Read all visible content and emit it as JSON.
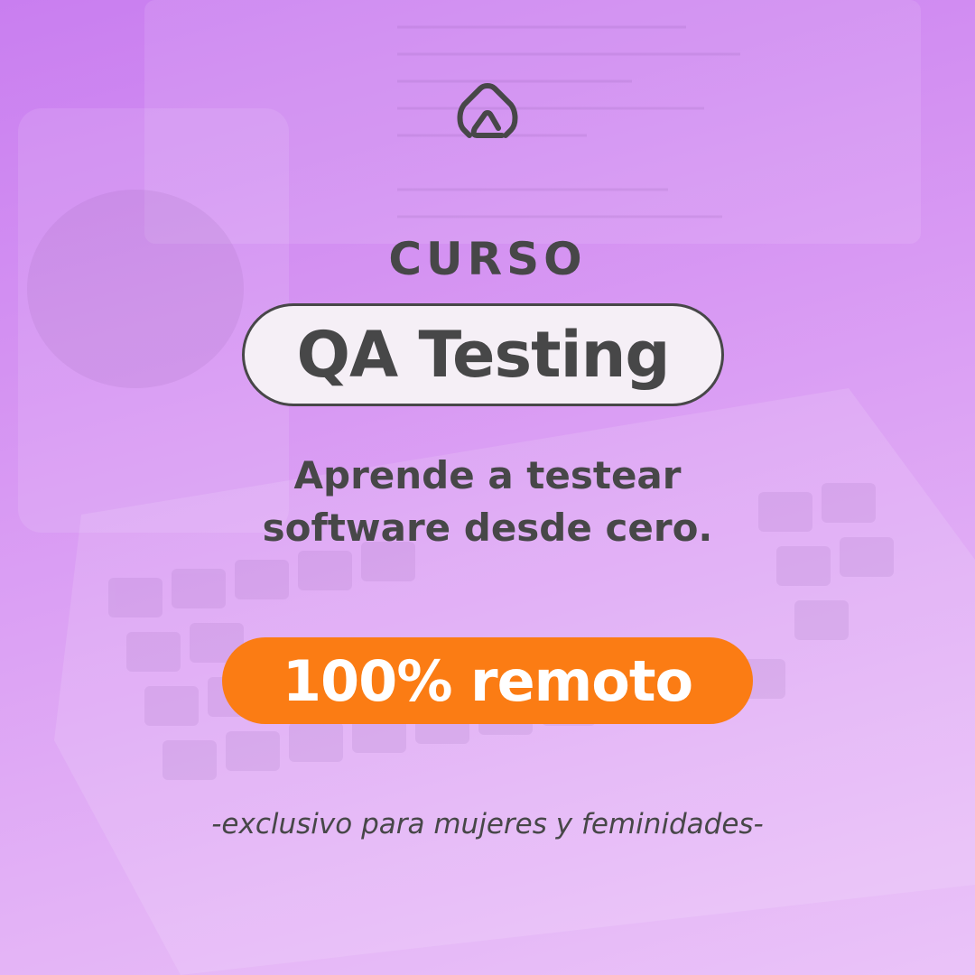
{
  "logo": {
    "icon": "brand-logo-icon"
  },
  "heading": {
    "kicker": "CURSO",
    "title": "QA Testing"
  },
  "subtitle": {
    "line1": "Aprende a testear",
    "line2": "software desde cero."
  },
  "badge": {
    "label": "100% remoto"
  },
  "footer": {
    "text": "-exclusivo para mujeres y feminidades-"
  },
  "colors": {
    "background": "#d899f3",
    "text": "#474748",
    "pill_fill": "#f5eff6",
    "accent": "#fb7c14",
    "badge_text": "#ffffff"
  }
}
